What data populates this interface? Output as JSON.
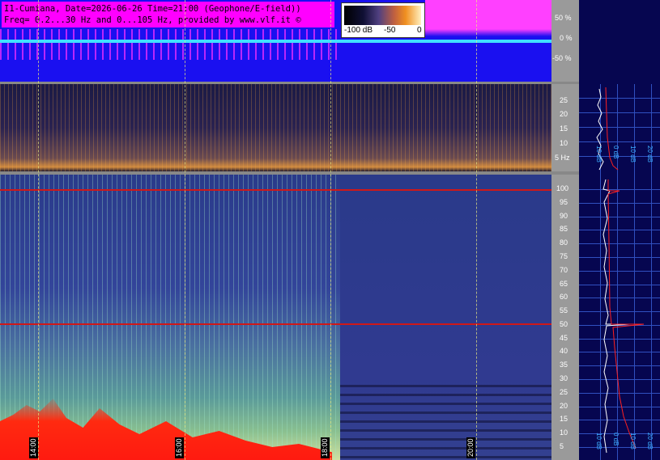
{
  "info": {
    "line1": "I1-Cumiana, Date=2026-06-26 Time=21:00 (Geophone/E-field))",
    "line2": "Freq= 0.2...30 Hz and 0...105 Hz, provided by www.vlf.it ©"
  },
  "colorbar": {
    "labels": [
      "-100 dB",
      "-50",
      "0"
    ]
  },
  "wave_axis": {
    "labels": [
      "50 %",
      "0 %",
      "-50 %"
    ]
  },
  "geo_axis": {
    "labels": [
      "25",
      "20",
      "15",
      "10",
      "5 Hz"
    ]
  },
  "efield_axis": {
    "labels": [
      "100",
      "95",
      "90",
      "85",
      "80",
      "75",
      "70",
      "65",
      "60",
      "55",
      "50",
      "45",
      "40",
      "35",
      "30",
      "25",
      "20",
      "15",
      "10",
      "5"
    ]
  },
  "time_labels": [
    "14:00",
    "16:00",
    "18:00",
    "20:00"
  ],
  "panel_db_top": [
    "10 dB",
    "0 dB",
    "10 dB",
    "20 dB"
  ],
  "panel_db_bottom": [
    "10 dB",
    "0 dB",
    "10 dB",
    "20 dB"
  ],
  "colors": {
    "waveform_bg": "#1a10f0",
    "info_bg": "#ff00ff",
    "efield_line": "#d01818",
    "axis_bg": "#9a9a9a"
  }
}
